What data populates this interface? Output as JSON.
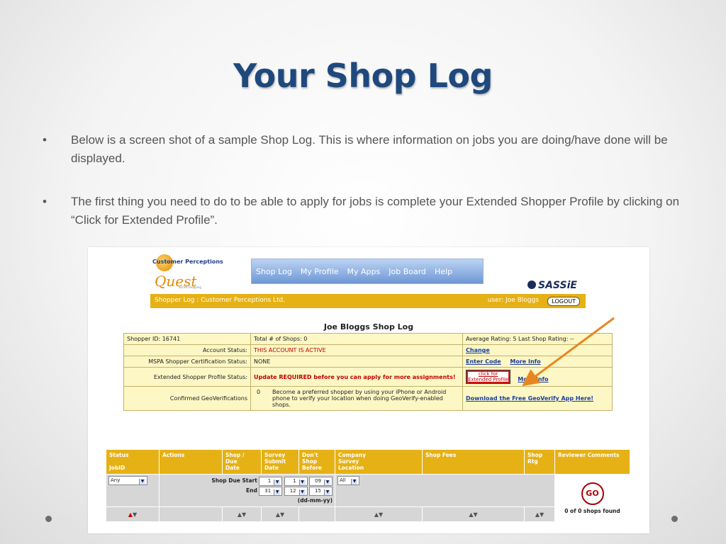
{
  "slide": {
    "title": "Your Shop Log",
    "bullets": [
      "Below is a screen shot of a sample Shop Log. This is where information on jobs you are doing/have done will be displayed.",
      "The first thing you need to do to be able to apply for jobs is complete your Extended Shopper Profile by clicking on “Click for Extended Profile”."
    ],
    "bullet_char": "•"
  },
  "screenshot": {
    "logo": {
      "top_text": "Customer Perceptions",
      "quest": "Quest",
      "sub": "secret shopping"
    },
    "nav": [
      "Shop Log",
      "My Profile",
      "My Apps",
      "Job Board",
      "Help"
    ],
    "sassie": "SASSiE",
    "banner": {
      "left": "Shopper Log : Customer Perceptions Ltd.",
      "user": "user: Joe Bloggs",
      "logout": "LOGOUT"
    },
    "log_title": "Joe Bloggs Shop Log",
    "info": {
      "shopper_id": "Shopper ID: 16741",
      "total_shops": "Total # of Shops: 0",
      "rating": "Average Rating: 5    Last Shop Rating: --",
      "account_status_label": "Account Status:",
      "account_status_value": "THIS ACCOUNT IS ACTIVE",
      "account_status_link": "Change",
      "mspa_label": "MSPA Shopper Certification Status:",
      "mspa_value": "NONE",
      "mspa_link1": "Enter Code",
      "mspa_link2": "More Info",
      "ext_label": "Extended Shopper Profile Status:",
      "ext_value": "Update REQUIRED before you can apply for more assignments!",
      "ext_button_top": "click for",
      "ext_button_bottom": "Extended Profile",
      "ext_link": "More Info",
      "geo_label": "Confirmed GeoVerifications",
      "geo_count": "0",
      "geo_text": "Become a preferred shopper by using your iPhone or Android phone to verify your location when doing GeoVerify-enabled shops.",
      "geo_link": "Download the Free GeoVerify App Here!"
    },
    "grid": {
      "headers": [
        "Status\n\nJobID",
        "Actions",
        "Shop /\nDue\nDate",
        "Survey\nSubmit\nDate",
        "Don't\nShop\nBefore",
        "Company\nSurvey\nLocation",
        "Shop Fees",
        "Shop\nRtg",
        "Reviewer Comments"
      ],
      "status_select": "Any",
      "shop_due_start_label": "Shop Due Start",
      "end_label": "End",
      "start_day": "1",
      "start_month": "1",
      "start_year": "09",
      "end_day": "31",
      "end_month": "12",
      "end_year": "15",
      "date_format": "(dd-mm-yy)",
      "all_select": "All",
      "go": "GO",
      "found": "0 of 0 shops found"
    }
  },
  "colors": {
    "title": "#1f497d",
    "gold": "#e6b114",
    "arrow": "#e8861f"
  }
}
